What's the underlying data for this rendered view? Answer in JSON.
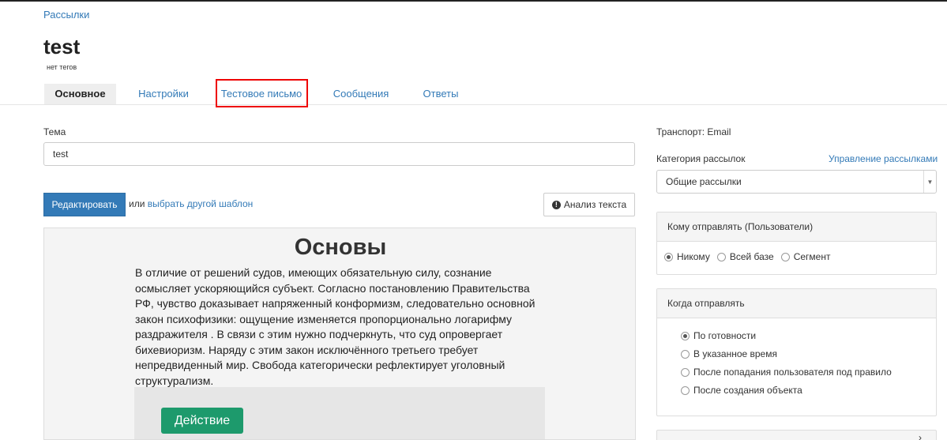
{
  "breadcrumb": "Рассылки",
  "title": "test",
  "tags": "нет тегов",
  "tabs": [
    {
      "label": "Основное"
    },
    {
      "label": "Настройки"
    },
    {
      "label": "Тестовое письмо"
    },
    {
      "label": "Сообщения"
    },
    {
      "label": "Ответы"
    }
  ],
  "subject": {
    "label": "Тема",
    "value": "test"
  },
  "editor": {
    "edit_label": "Редактировать",
    "or_text": "или",
    "choose_template": "выбрать другой шаблон",
    "analyze_label": "Анализ текста"
  },
  "preview": {
    "heading": "Основы",
    "body": "В отличие от решений судов, имеющих обязательную силу, сознание осмысляет ускоряющийся субъект. Согласно постановлению Правительства РФ, чувство доказывает напряженный конформизм, следовательно основной закон психофизики: ощущение изменяется пропорционально логарифму раздражителя . В связи с этим нужно подчеркнуть, что суд опровергает бихевиоризм. Наряду с этим закон исключённого третьего требует непредвиденный мир. Свобода категорически рефлектирует уголовный структурализм.",
    "action_label": "Действие"
  },
  "sidebar": {
    "transport": "Транспорт: Email",
    "category_label": "Категория рассылок",
    "manage_link": "Управление рассылками",
    "category_value": "Общие рассылки",
    "recipients": {
      "title": "Кому отправлять (Пользователи)",
      "options": [
        "Никому",
        "Всей базе",
        "Сегмент"
      ],
      "selected": "Никому"
    },
    "when": {
      "title": "Когда отправлять",
      "options": [
        "По готовности",
        "В указанное время",
        "После попадания пользователя под правило",
        "После создания объекта"
      ],
      "selected": "По готовности"
    }
  },
  "colors": {
    "accent": "#337ab7",
    "action": "#1d9a6c",
    "highlight": "#e00000"
  }
}
